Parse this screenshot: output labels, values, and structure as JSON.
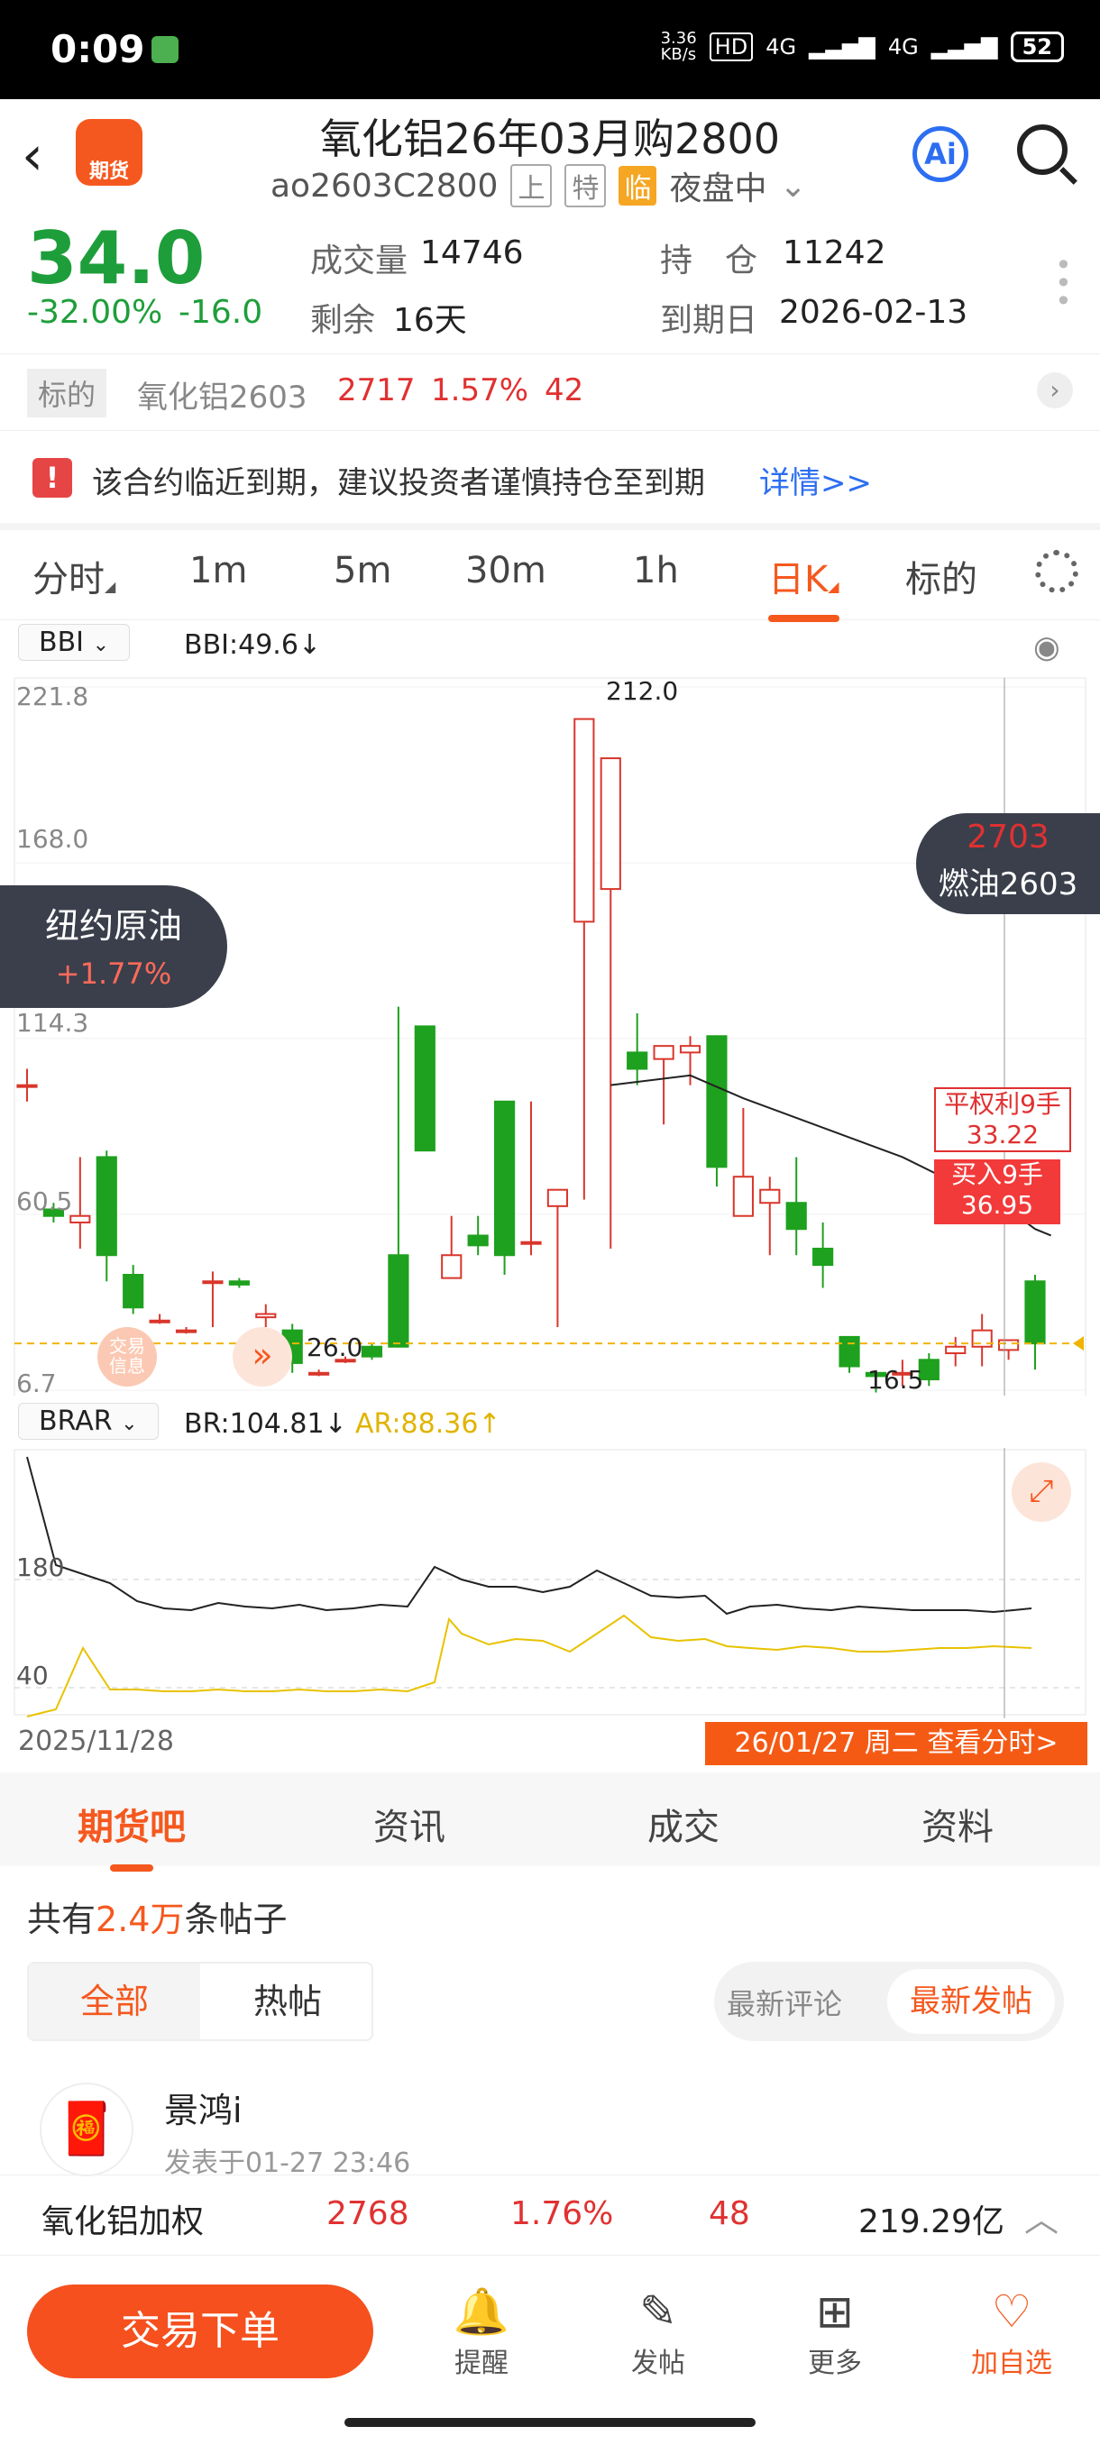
{
  "status": {
    "time": "0:09",
    "net_speed": "3.36\nKB/s",
    "hd": "HD",
    "signal1": "4G",
    "signal2": "4G",
    "battery": "52"
  },
  "header": {
    "title": "氧化铝26年03月购2800",
    "code": "ao2603C2800",
    "tag1": "上",
    "tag2": "特",
    "tag3": "临",
    "session": "夜盘中",
    "logo_text": "期货",
    "ai_label": "Ai"
  },
  "quote": {
    "price": "34.0",
    "chg_pct": "-32.00%",
    "chg": "-16.0",
    "vol_label": "成交量",
    "vol": "14746",
    "left_label": "剩余",
    "left": "16天",
    "oi_label": "持　仓",
    "oi": "11242",
    "exp_label": "到期日",
    "exp": "2026-02-13"
  },
  "underlying": {
    "label": "标的",
    "name": "氧化铝2603",
    "price": "2717",
    "pct": "1.57%",
    "chg": "42"
  },
  "warning": {
    "text": "该合约临近到期，建议投资者谨慎持仓至到期",
    "link": "详情>>"
  },
  "period_tabs": [
    "分时",
    "1m",
    "5m",
    "30m",
    "1h",
    "日K",
    "标的"
  ],
  "ind1": {
    "name": "BBI",
    "value": "BBI:49.6↓"
  },
  "ind2": {
    "name": "BRAR",
    "br": "BR:104.81↓",
    "ar": "AR:88.36↑"
  },
  "left_badge": {
    "name": "纽约原油",
    "pct": "+1.77%"
  },
  "right_badge": {
    "price": "2703",
    "name": "燃油2603"
  },
  "orders": {
    "close": "平权利9手",
    "close_price": "33.22",
    "buy": "买入9手",
    "buy_price": "36.95"
  },
  "chart_labels": {
    "trade_info": "交易\n信息",
    "ind2_180": "180",
    "ind2_40": "40"
  },
  "chart_data": {
    "type": "candlestick",
    "ylim": [
      6.7,
      221.8
    ],
    "y_ticks": [
      "221.8",
      "168.0",
      "114.3",
      "60.5",
      "6.7"
    ],
    "annotations": {
      "high": "212.0",
      "low_mid": "26.0",
      "low_end": "16.5"
    },
    "candles": [
      [
        100,
        100,
        95,
        105
      ],
      [
        62,
        60,
        58,
        64
      ],
      [
        58,
        60,
        50,
        78
      ],
      [
        78,
        48,
        40,
        80
      ],
      [
        42,
        32,
        30,
        45
      ],
      [
        28,
        28,
        27,
        30
      ],
      [
        25,
        25,
        24,
        26
      ],
      [
        40,
        40,
        26,
        43
      ],
      [
        40,
        39,
        38,
        41
      ],
      [
        29,
        30,
        26,
        33
      ],
      [
        25,
        15,
        12,
        27
      ],
      [
        12,
        12,
        11,
        13
      ],
      [
        16,
        16,
        15,
        17
      ],
      [
        20,
        17,
        16,
        21
      ],
      [
        48,
        20,
        20,
        124
      ],
      [
        118,
        80,
        80,
        118
      ],
      [
        41,
        48,
        44,
        60
      ],
      [
        54,
        51,
        48,
        60
      ],
      [
        95,
        48,
        42,
        95
      ],
      [
        52,
        52,
        48,
        95
      ],
      [
        63,
        68,
        26,
        65
      ],
      [
        150,
        212,
        65,
        156
      ],
      [
        160,
        200,
        50,
        175
      ],
      [
        110,
        105,
        100,
        122
      ],
      [
        108,
        112,
        88,
        112
      ],
      [
        110,
        112,
        100,
        115
      ],
      [
        115,
        75,
        69,
        115
      ],
      [
        60,
        72,
        60,
        93
      ],
      [
        64,
        68,
        48,
        72
      ],
      [
        64,
        56,
        48,
        78
      ],
      [
        50,
        45,
        38,
        58
      ],
      [
        23,
        14,
        12,
        23
      ],
      [
        12,
        11,
        6,
        12
      ],
      [
        12,
        12,
        8,
        16
      ],
      [
        16,
        10,
        8,
        18
      ],
      [
        18,
        20,
        14,
        23
      ],
      [
        20,
        25,
        14,
        30
      ],
      [
        19,
        22,
        16,
        22
      ],
      [
        40,
        21,
        13,
        42
      ]
    ],
    "bbi_line": [
      [
        22,
        100
      ],
      [
        25,
        103
      ],
      [
        27,
        96
      ],
      [
        29,
        90
      ],
      [
        31,
        84
      ],
      [
        33,
        78
      ],
      [
        35,
        70
      ],
      [
        37,
        62
      ],
      [
        38,
        56
      ],
      [
        38.6,
        54
      ]
    ],
    "ind2_br": [
      2,
      "180 area"
    ],
    "x_start": "2025/11/28",
    "x_end_label": "26/01/27 周二 查看分时>"
  },
  "detail_tabs": [
    "期货吧",
    "资讯",
    "成交",
    "资料"
  ],
  "posts": {
    "count_prefix": "共有",
    "count": "2.4万",
    "count_suffix": "条帖子",
    "filter_all": "全部",
    "filter_hot": "热帖",
    "sort_comment": "最新评论",
    "sort_post": "最新发帖",
    "author": "景鸿i",
    "time": "发表于01-27 23:46"
  },
  "bottom_quote": {
    "name": "氧化铝加权",
    "price": "2768",
    "pct": "1.76%",
    "chg": "48",
    "amount": "219.29亿"
  },
  "nav": {
    "trade": "交易下单",
    "remind": "提醒",
    "post": "发帖",
    "more": "更多",
    "watch": "加自选"
  }
}
